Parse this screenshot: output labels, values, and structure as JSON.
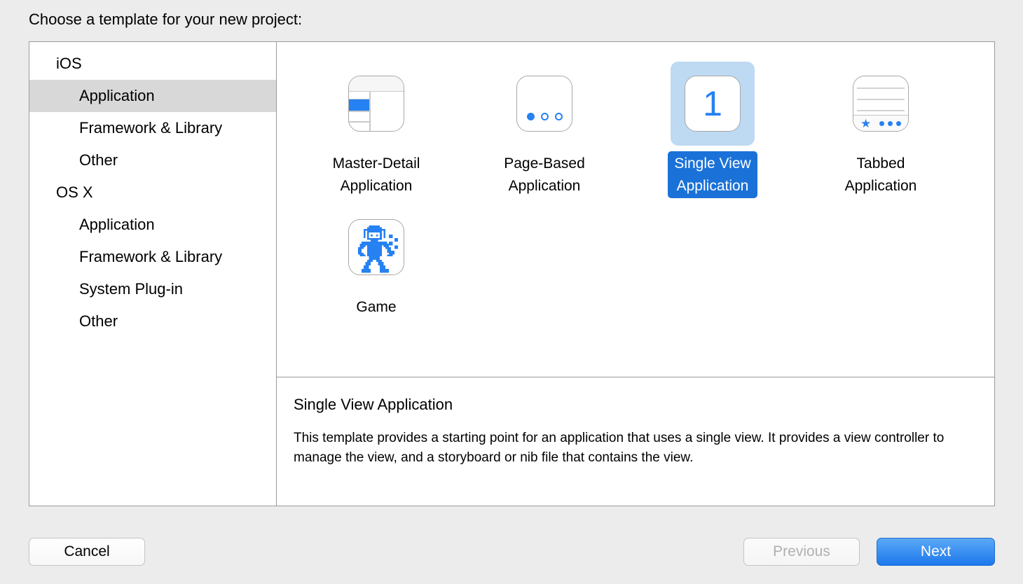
{
  "prompt": "Choose a template for your new project:",
  "sidebar": {
    "items": [
      {
        "label": "iOS",
        "level": "group",
        "selected": false
      },
      {
        "label": "Application",
        "level": "child",
        "selected": true
      },
      {
        "label": "Framework & Library",
        "level": "child",
        "selected": false
      },
      {
        "label": "Other",
        "level": "child",
        "selected": false
      },
      {
        "label": "OS X",
        "level": "group",
        "selected": false
      },
      {
        "label": "Application",
        "level": "child",
        "selected": false
      },
      {
        "label": "Framework & Library",
        "level": "child",
        "selected": false
      },
      {
        "label": "System Plug-in",
        "level": "child",
        "selected": false
      },
      {
        "label": "Other",
        "level": "child",
        "selected": false
      }
    ]
  },
  "templates": [
    {
      "label": "Master-Detail\nApplication",
      "icon": "master-detail-icon",
      "selected": false
    },
    {
      "label": "Page-Based\nApplication",
      "icon": "page-based-icon",
      "selected": false
    },
    {
      "label": "Single View\nApplication",
      "icon": "single-view-icon",
      "selected": true,
      "badge": "1"
    },
    {
      "label": "Tabbed\nApplication",
      "icon": "tabbed-icon",
      "selected": false
    },
    {
      "label": "Game",
      "icon": "game-robot-icon",
      "selected": false
    }
  ],
  "description": {
    "title": "Single View Application",
    "body": "This template provides a starting point for an application that uses a single view. It provides a view controller to manage the view, and a storyboard or nib file that contains the view."
  },
  "footer": {
    "cancel_label": "Cancel",
    "previous_label": "Previous",
    "next_label": "Next"
  },
  "colors": {
    "accent_blue": "#2681f2",
    "selection_label_blue": "#1a72d8",
    "selection_icon_blue": "#bed9f2",
    "sidebar_selection_gray": "#d8d8d8",
    "window_background": "#ececec"
  }
}
